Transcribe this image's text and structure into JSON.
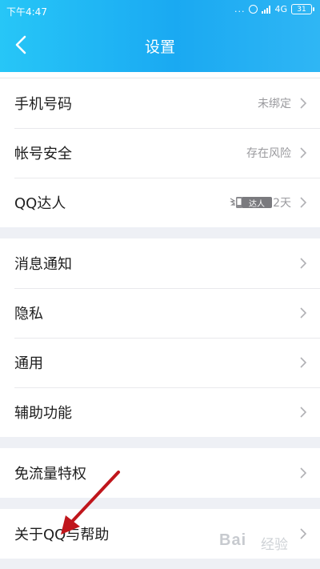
{
  "status_bar": {
    "time": "下午4:47",
    "dots": "...",
    "network": "4G",
    "network_sub": "all",
    "battery": "31"
  },
  "nav": {
    "back_icon": "chevron-left-icon",
    "title": "设置"
  },
  "groups": [
    {
      "items": [
        {
          "label": "手机号码",
          "value": "未绑定"
        },
        {
          "label": "帐号安全",
          "value": "存在风险"
        },
        {
          "label": "QQ达人",
          "badge": "达人",
          "value": "2天"
        }
      ]
    },
    {
      "items": [
        {
          "label": "消息通知"
        },
        {
          "label": "隐私"
        },
        {
          "label": "通用"
        },
        {
          "label": "辅助功能"
        }
      ]
    },
    {
      "items": [
        {
          "label": "免流量特权"
        }
      ]
    },
    {
      "items": [
        {
          "label": "关于QQ与帮助"
        }
      ]
    }
  ],
  "annotation": {
    "color": "#c0161c"
  },
  "watermark": {
    "text": "Bai",
    "sub": "经验"
  },
  "colors": {
    "header_start": "#27c6f7",
    "header_end": "#1aa9f2",
    "background": "#eef0f5",
    "label": "#1e1e1e",
    "value": "#9a9a9e"
  }
}
